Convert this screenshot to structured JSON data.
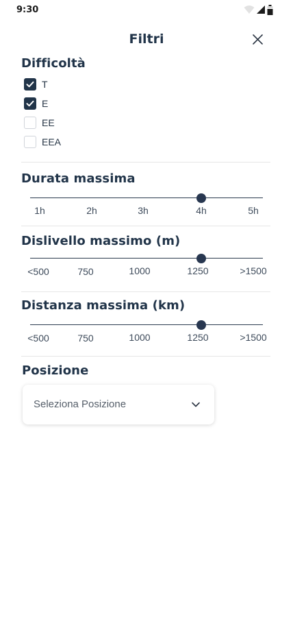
{
  "status_bar": {
    "time": "9:30",
    "icons": [
      "wifi-icon",
      "signal-icon",
      "battery-icon"
    ]
  },
  "header": {
    "title": "Filtri",
    "close_icon": "close-icon"
  },
  "difficulty": {
    "title": "Difficoltà",
    "options": [
      {
        "label": "T",
        "checked": true
      },
      {
        "label": "E",
        "checked": true
      },
      {
        "label": "EE",
        "checked": false
      },
      {
        "label": "EEA",
        "checked": false
      }
    ]
  },
  "duration": {
    "title": "Durata massima",
    "ticks": [
      "1h",
      "2h",
      "3h",
      "4h",
      "5h"
    ],
    "selected": "4h"
  },
  "elevation": {
    "title": "Dislivello massimo (m)",
    "ticks": [
      "<500",
      "750",
      "1000",
      "1250",
      ">1500"
    ],
    "selected": "1250"
  },
  "distance": {
    "title": "Distanza massima (km)",
    "ticks": [
      "<500",
      "750",
      "1000",
      "1250",
      ">1500"
    ],
    "selected": "1250"
  },
  "position": {
    "title": "Posizione",
    "placeholder": "Seleziona Posizione",
    "chevron_icon": "chevron-down-icon"
  },
  "colors": {
    "primary": "#213449",
    "divider": "#e6e6e6"
  }
}
